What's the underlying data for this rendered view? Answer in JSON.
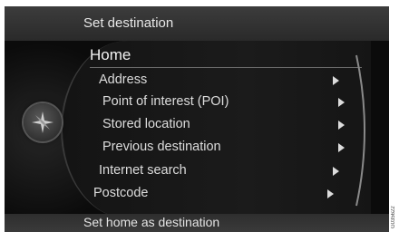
{
  "header": {
    "title": "Set destination"
  },
  "menu": {
    "home": "Home",
    "items": [
      {
        "label": "Address"
      },
      {
        "label": "Point of interest (POI)"
      },
      {
        "label": "Stored location"
      },
      {
        "label": "Previous destination"
      },
      {
        "label": "Internet search"
      },
      {
        "label": "Postcode"
      }
    ]
  },
  "footer": {
    "label": "Set home as destination"
  },
  "knob": {
    "icon": "compass-icon"
  },
  "watermark": "G035622"
}
